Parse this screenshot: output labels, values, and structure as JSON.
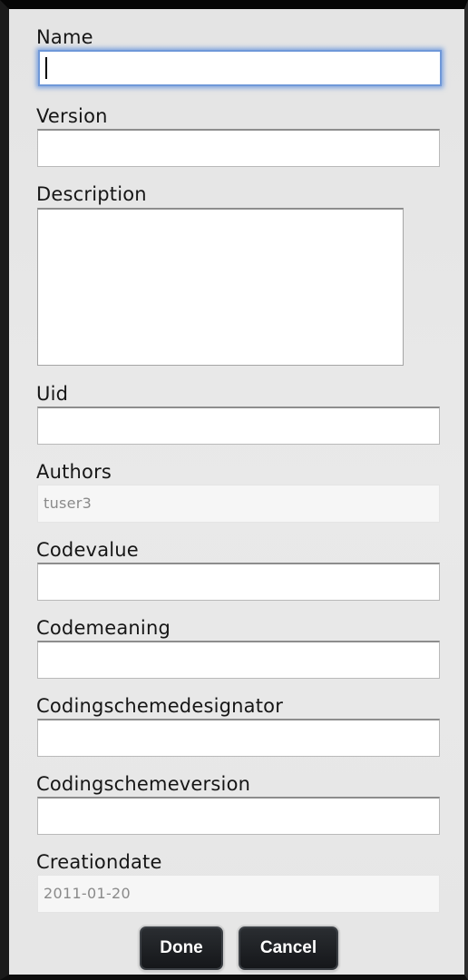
{
  "form": {
    "name_label": "Name",
    "name_value": "",
    "version_label": "Version",
    "version_value": "",
    "description_label": "Description",
    "description_value": "",
    "uid_label": "Uid",
    "uid_value": "",
    "authors_label": "Authors",
    "authors_value": "tuser3",
    "codevalue_label": "Codevalue",
    "codevalue_value": "",
    "codemeaning_label": "Codemeaning",
    "codemeaning_value": "",
    "codingschemedesignator_label": "Codingschemedesignator",
    "codingschemedesignator_value": "",
    "codingschemeversion_label": "Codingschemeversion",
    "codingschemeversion_value": "",
    "creationdate_label": "Creationdate",
    "creationdate_value": "2011-01-20"
  },
  "buttons": {
    "done_label": "Done",
    "cancel_label": "Cancel"
  },
  "colors": {
    "focus_ring": "#6f98d8",
    "button_bg": "#1f2226",
    "dialog_bg": "#e7e7e7"
  }
}
